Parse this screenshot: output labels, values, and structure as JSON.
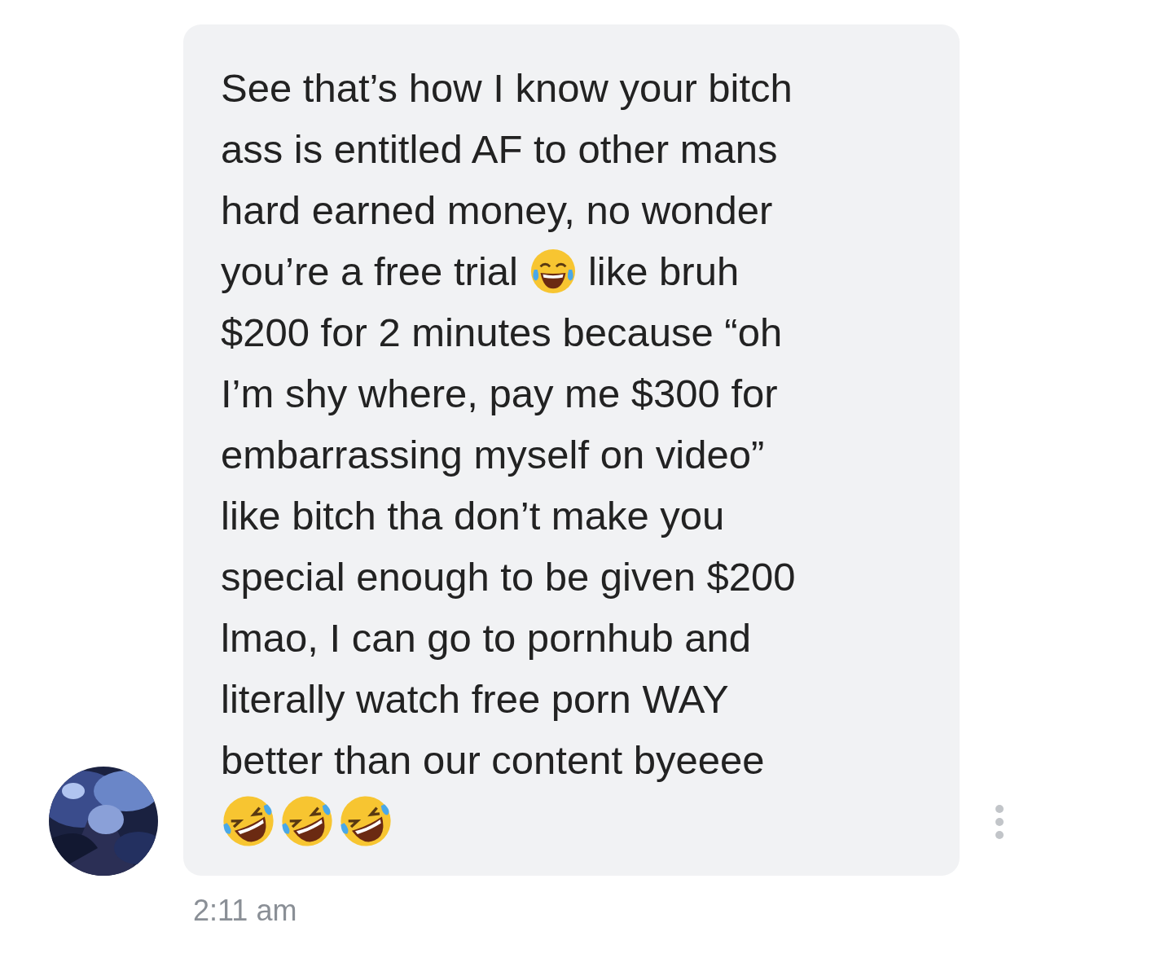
{
  "message": {
    "lines": [
      {
        "parts": [
          {
            "kind": "text",
            "text": "See that’s how I know your bitch"
          }
        ]
      },
      {
        "parts": [
          {
            "kind": "text",
            "text": "ass is entitled AF to other mans"
          }
        ]
      },
      {
        "parts": [
          {
            "kind": "text",
            "text": "hard earned money, no wonder"
          }
        ]
      },
      {
        "parts": [
          {
            "kind": "text",
            "text": "you’re a free trial"
          },
          {
            "kind": "joy"
          },
          {
            "kind": "text",
            "text": "like bruh"
          }
        ]
      },
      {
        "parts": [
          {
            "kind": "text",
            "text": "$200 for 2 minutes because “oh"
          }
        ]
      },
      {
        "parts": [
          {
            "kind": "text",
            "text": "I’m shy where, pay me $300 for"
          }
        ]
      },
      {
        "parts": [
          {
            "kind": "text",
            "text": "embarrassing myself on video”"
          }
        ]
      },
      {
        "parts": [
          {
            "kind": "text",
            "text": "like bitch tha don’t make you"
          }
        ]
      },
      {
        "parts": [
          {
            "kind": "text",
            "text": "special enough to be given $200"
          }
        ]
      },
      {
        "parts": [
          {
            "kind": "text",
            "text": "lmao, I can go to pornhub and"
          }
        ]
      },
      {
        "parts": [
          {
            "kind": "text",
            "text": "literally watch free porn WAY"
          }
        ]
      },
      {
        "parts": [
          {
            "kind": "text",
            "text": "better than our content byeeee"
          }
        ]
      },
      {
        "parts": [
          {
            "kind": "rofl"
          },
          {
            "kind": "rofl"
          },
          {
            "kind": "rofl"
          }
        ]
      }
    ],
    "time": "2:11 am"
  }
}
